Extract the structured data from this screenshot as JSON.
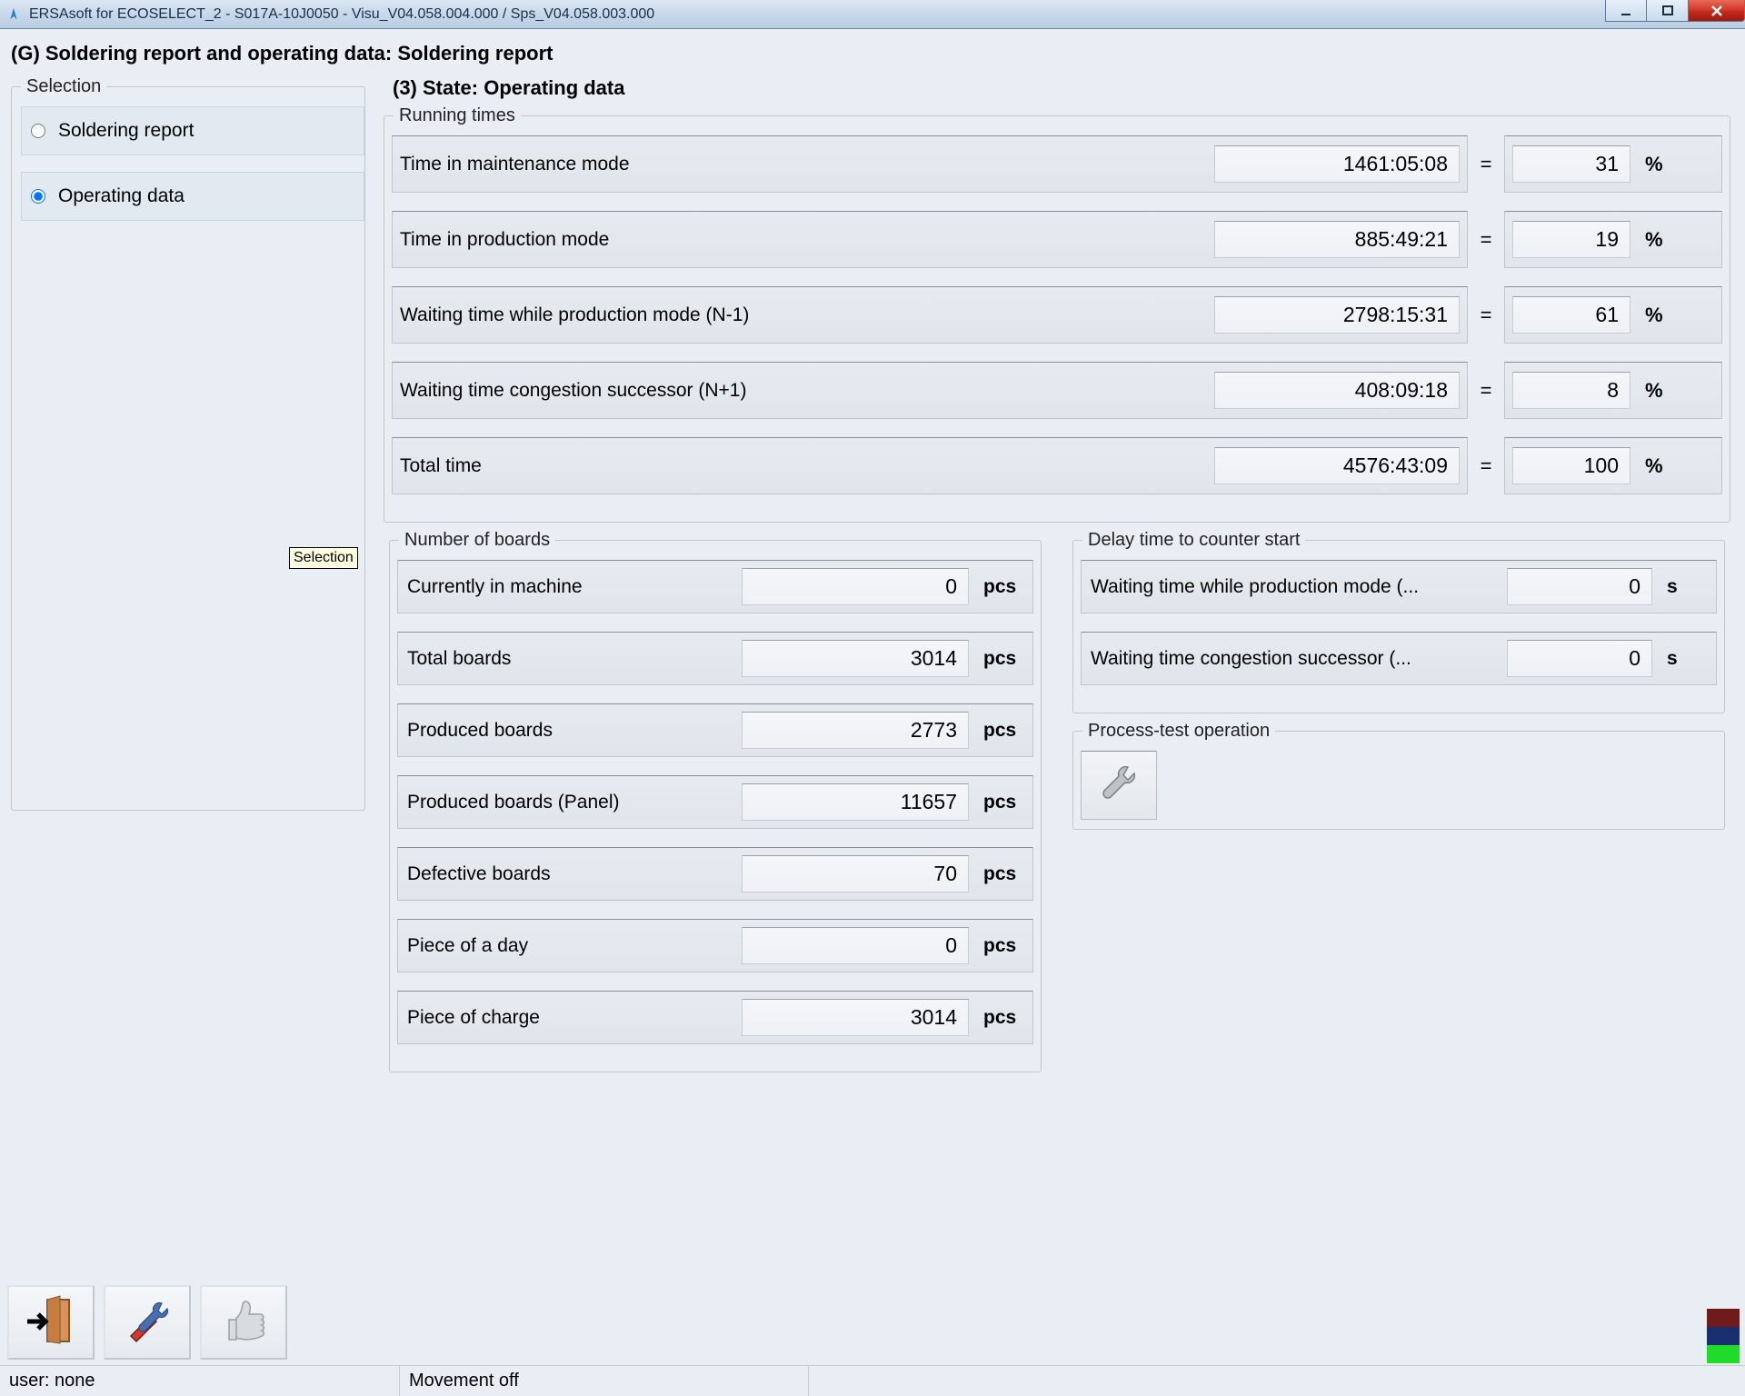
{
  "window": {
    "title": "ERSAsoft for ECOSELECT_2 - S017A-10J0050 - Visu_V04.058.004.000 / Sps_V04.058.003.000"
  },
  "page_title": "(G) Soldering report and operating data: Soldering report",
  "selection": {
    "legend": "Selection",
    "options": [
      {
        "label": "Soldering report",
        "checked": false
      },
      {
        "label": "Operating data",
        "checked": true
      }
    ],
    "tooltip": "Selection"
  },
  "state_title": "(3) State: Operating data",
  "running_times": {
    "legend": "Running times",
    "rows": [
      {
        "label": "Time in maintenance mode",
        "value": "1461:05:08",
        "pct": "31"
      },
      {
        "label": "Time in production mode",
        "value": "885:49:21",
        "pct": "19"
      },
      {
        "label": "Waiting time while production mode (N-1)",
        "value": "2798:15:31",
        "pct": "61"
      },
      {
        "label": "Waiting time congestion successor (N+1)",
        "value": "408:09:18",
        "pct": "8"
      },
      {
        "label": "Total time",
        "value": "4576:43:09",
        "pct": "100"
      }
    ],
    "eq": "=",
    "pct_sign": "%"
  },
  "number_of_boards": {
    "legend": "Number of boards",
    "unit": "pcs",
    "rows": [
      {
        "label": "Currently in machine",
        "value": "0"
      },
      {
        "label": "Total boards",
        "value": "3014"
      },
      {
        "label": "Produced boards",
        "value": "2773"
      },
      {
        "label": "Produced boards (Panel)",
        "value": "11657"
      },
      {
        "label": "Defective boards",
        "value": "70"
      },
      {
        "label": "Piece of a day",
        "value": "0"
      },
      {
        "label": "Piece of charge",
        "value": "3014"
      }
    ]
  },
  "delay_time": {
    "legend": "Delay time to counter start",
    "unit": "s",
    "rows": [
      {
        "label": "Waiting time while production mode (...",
        "value": "0"
      },
      {
        "label": "Waiting time congestion successor (...",
        "value": "0"
      }
    ]
  },
  "process_test": {
    "legend": "Process-test operation"
  },
  "status": {
    "user": "user: none",
    "movement": "Movement off"
  }
}
